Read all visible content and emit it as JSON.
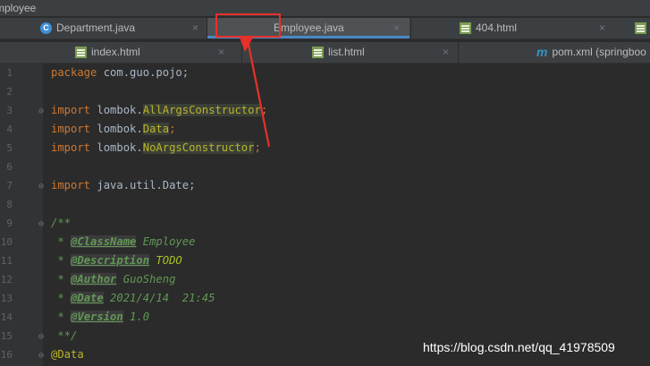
{
  "window": {
    "title": "mployee"
  },
  "tabs_row1": [
    {
      "label": "Department.java",
      "icon": "java-class-icon"
    },
    {
      "label": "Employee.java",
      "icon": "java-class-icon",
      "active": true
    },
    {
      "label": "404.html",
      "icon": "html-file-icon"
    },
    {
      "label": "",
      "icon": "html-file-icon"
    }
  ],
  "tabs_row2": [
    {
      "label": "index.html",
      "icon": "html-file-icon"
    },
    {
      "label": "list.html",
      "icon": "html-file-icon"
    },
    {
      "label": "pom.xml (springboo",
      "icon": "maven-icon"
    }
  ],
  "close_glyph": "×",
  "line_numbers": [
    "1",
    "2",
    "3",
    "4",
    "5",
    "6",
    "7",
    "8",
    "9",
    "10",
    "11",
    "12",
    "13",
    "14",
    "15",
    "16"
  ],
  "code": {
    "l1_kw": "package",
    "l1_rest": " com.guo.pojo;",
    "kw_import": "import",
    "l3_pre": " lombok.",
    "l3_hl": "AllArgsConstructor",
    "l3_end": ";",
    "l4_pre": " lombok.",
    "l4_hl": "Data",
    "l4_end": ";",
    "l5_pre": " lombok.",
    "l5_hl": "NoArgsConstructor",
    "l5_end": ";",
    "l7_rest": " java.util.Date;",
    "l9": "/**",
    "doc_star": " * ",
    "l10_tag": "@ClassName",
    "l10_val": " Employee",
    "l11_tag": "@Description",
    "l11_val": " TODO",
    "l12_tag": "@Author",
    "l12_val": " GuoSheng",
    "l13_tag": "@Date",
    "l13_val": " 2021/4/14  21:45",
    "l14_tag": "@Version",
    "l14_val": " 1.0",
    "l15": " **/",
    "l16": "@Data"
  },
  "watermark": "https://blog.csdn.net/qq_41978509",
  "colors": {
    "accent": "#4a88c7",
    "annotation_red": "#e8302a"
  }
}
